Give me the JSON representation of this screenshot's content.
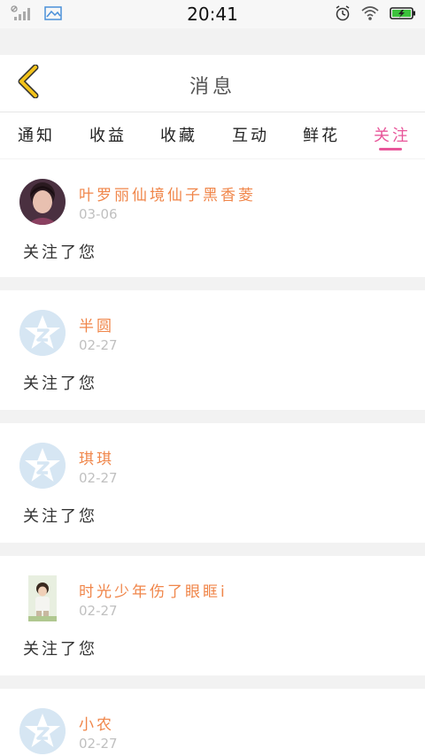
{
  "status_bar": {
    "time": "20:41",
    "icons": [
      "no-sim-signal-icon",
      "gallery-icon",
      "alarm-icon",
      "wifi-icon",
      "battery-charging-icon"
    ]
  },
  "header": {
    "title": "消息",
    "back_icon": "chevron-left-icon",
    "accent_color": "#f2c21b"
  },
  "tabs": {
    "items": [
      {
        "label": "通知",
        "active": false
      },
      {
        "label": "收益",
        "active": false
      },
      {
        "label": "收藏",
        "active": false
      },
      {
        "label": "互动",
        "active": false
      },
      {
        "label": "鲜花",
        "active": false
      },
      {
        "label": "关注",
        "active": true
      }
    ],
    "active_color": "#e8569a"
  },
  "messages": [
    {
      "username": "叶罗丽仙境仙子黑香菱",
      "date": "03-06",
      "text": "关注了您",
      "avatar": "photo-avatar"
    },
    {
      "username": "半圆",
      "date": "02-27",
      "text": "关注了您",
      "avatar": "default-star-avatar"
    },
    {
      "username": "琪琪",
      "date": "02-27",
      "text": "关注了您",
      "avatar": "default-star-avatar"
    },
    {
      "username": "时光少年伤了眼眶i",
      "date": "02-27",
      "text": "关注了您",
      "avatar": "photo-avatar"
    },
    {
      "username": "小农",
      "date": "02-27",
      "text": "",
      "avatar": "default-star-avatar"
    }
  ],
  "colors": {
    "username": "#f0864a",
    "date": "#c0c0c0",
    "separator": "#f2f2f2"
  }
}
